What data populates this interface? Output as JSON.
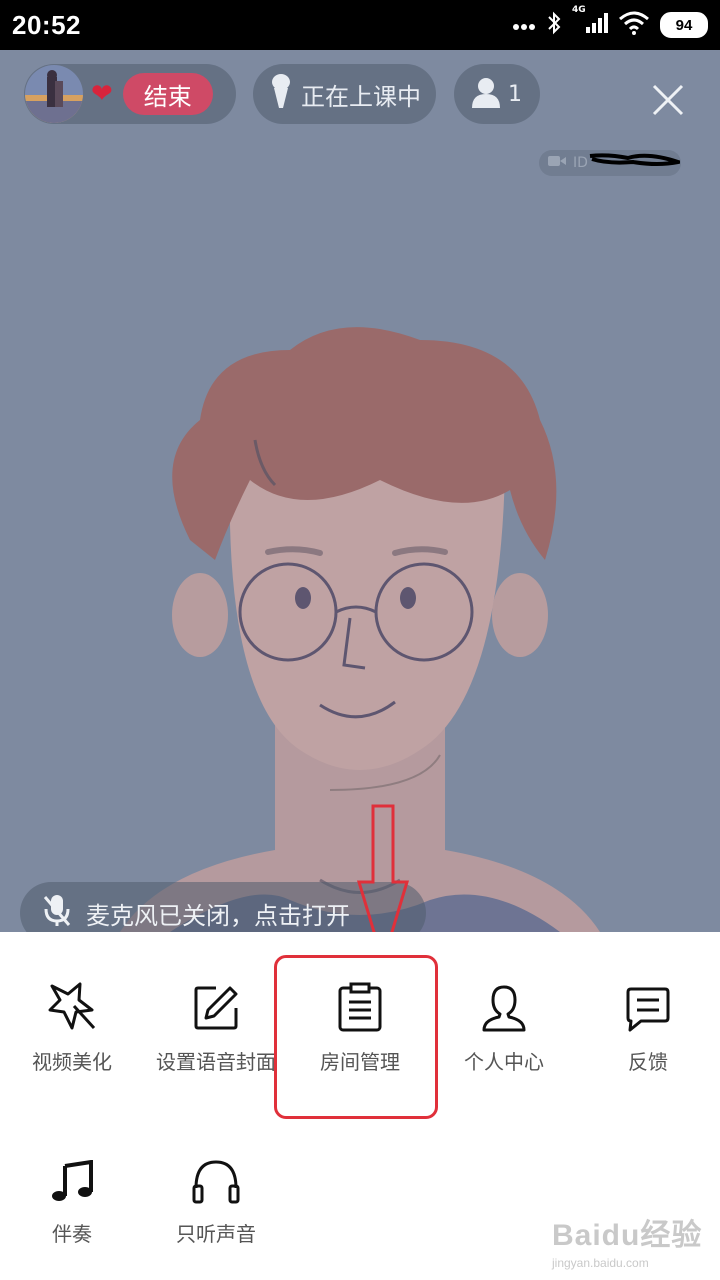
{
  "status_bar": {
    "time": "20:52",
    "network": "4G",
    "battery": "94",
    "icons": [
      "dots-icon",
      "bluetooth-icon",
      "signal-icon",
      "wifi-icon",
      "battery-icon"
    ]
  },
  "header": {
    "end_label": "结束",
    "class_status": "正在上课中",
    "people_count": "1",
    "id_label": "ID"
  },
  "mic_notice": "麦克风已关闭，点击打开",
  "menu": {
    "items": [
      {
        "label": "视频美化",
        "icon": "magic-wand-icon"
      },
      {
        "label": "设置语音封面",
        "icon": "edit-icon"
      },
      {
        "label": "房间管理",
        "icon": "clipboard-icon"
      },
      {
        "label": "个人中心",
        "icon": "user-icon"
      },
      {
        "label": "反馈",
        "icon": "message-icon"
      },
      {
        "label": "伴奏",
        "icon": "music-note-icon"
      },
      {
        "label": "只听声音",
        "icon": "headphones-icon"
      }
    ]
  },
  "annotation": {
    "highlight_color": "#e0303a"
  },
  "watermark": {
    "brand": "Baidu经验",
    "url": "jingyan.baidu.com"
  }
}
